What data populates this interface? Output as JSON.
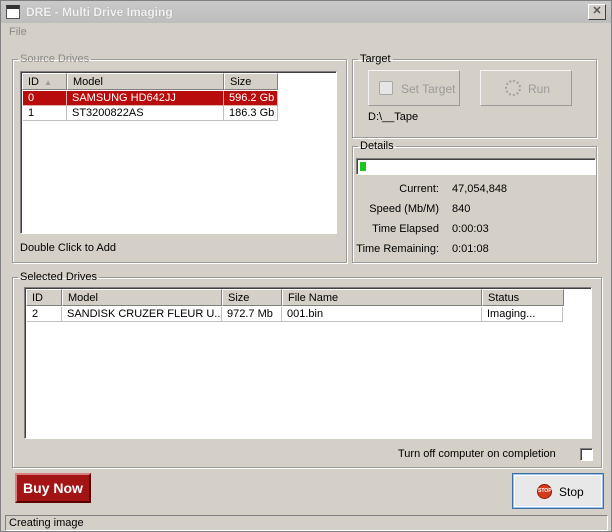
{
  "window": {
    "title": "DRE - Multi Drive Imaging",
    "close_glyph": "✕"
  },
  "menu": {
    "items": [
      "File"
    ]
  },
  "source_drives": {
    "legend": "Source Drives",
    "columns": [
      "ID",
      "Model",
      "Size"
    ],
    "sort_indicator": "▲",
    "rows": [
      {
        "id": "0",
        "model": "SAMSUNG HD642JJ",
        "size": "596.2 Gb",
        "selected": true
      },
      {
        "id": "1",
        "model": "ST3200822AS",
        "size": "186.3 Gb",
        "selected": false
      }
    ],
    "hint": "Double Click to Add"
  },
  "target": {
    "legend": "Target",
    "set_target_label": "Set Target",
    "run_label": "Run",
    "path": "D:\\__Tape"
  },
  "details": {
    "legend": "Details",
    "progress_fraction": 0.015,
    "fields": [
      {
        "label": "Current:",
        "value": "47,054,848"
      },
      {
        "label": "Speed (Mb/M)",
        "value": "840"
      },
      {
        "label": "Time Elapsed",
        "value": "0:00:03"
      },
      {
        "label": "Time Remaining:",
        "value": "0:01:08"
      }
    ]
  },
  "selected_drives": {
    "legend": "Selected Drives",
    "columns": [
      "ID",
      "Model",
      "Size",
      "File Name",
      "Status"
    ],
    "rows": [
      {
        "id": "2",
        "model": "SANDISK CRUZER FLEUR U...",
        "size": "972.7 Mb",
        "file_name": "001.bin",
        "status": "Imaging..."
      }
    ]
  },
  "options": {
    "turn_off_label": "Turn off computer on completion",
    "turn_off_checked": false
  },
  "buttons": {
    "buy_now": "Buy Now",
    "stop": "Stop",
    "stop_icon_text": "STOP"
  },
  "status_bar": {
    "text": "Creating image"
  },
  "icons": {
    "set_target": "drive-icon",
    "run": "gears-icon",
    "stop": "stop-sign-icon"
  }
}
